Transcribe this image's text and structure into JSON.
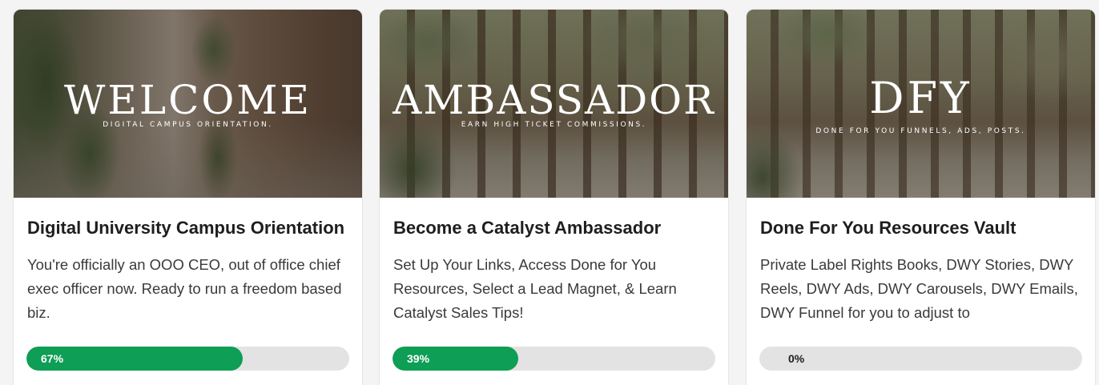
{
  "courses": [
    {
      "hero_title": "WELCOME",
      "hero_subtitle": "DIGITAL CAMPUS ORIENTATION.",
      "title": "Digital University Campus Orientation",
      "description": "You're officially an OOO CEO, out of office chief exec officer now. Ready to run a freedom based biz.",
      "progress": 67,
      "progress_label": "67%"
    },
    {
      "hero_title": "AMBASSADOR",
      "hero_subtitle": "EARN HIGH TICKET COMMISSIONS.",
      "title": "Become a Catalyst Ambassador",
      "description": "Set Up Your Links, Access Done for You Resources, Select a Lead Magnet, & Learn Catalyst Sales Tips!",
      "progress": 39,
      "progress_label": "39%"
    },
    {
      "hero_title": "DFY",
      "hero_subtitle": "DONE FOR YOU FUNNELS, ADS, POSTS.",
      "title": "Done For You Resources Vault",
      "description": "Private Label Rights Books, DWY Stories, DWY Reels, DWY Ads, DWY Carousels, DWY Emails, DWY Funnel for you to adjust to",
      "progress": 0,
      "progress_label": "0%"
    }
  ],
  "colors": {
    "progress_fill": "#0e9e55",
    "progress_track": "#e3e3e3"
  }
}
